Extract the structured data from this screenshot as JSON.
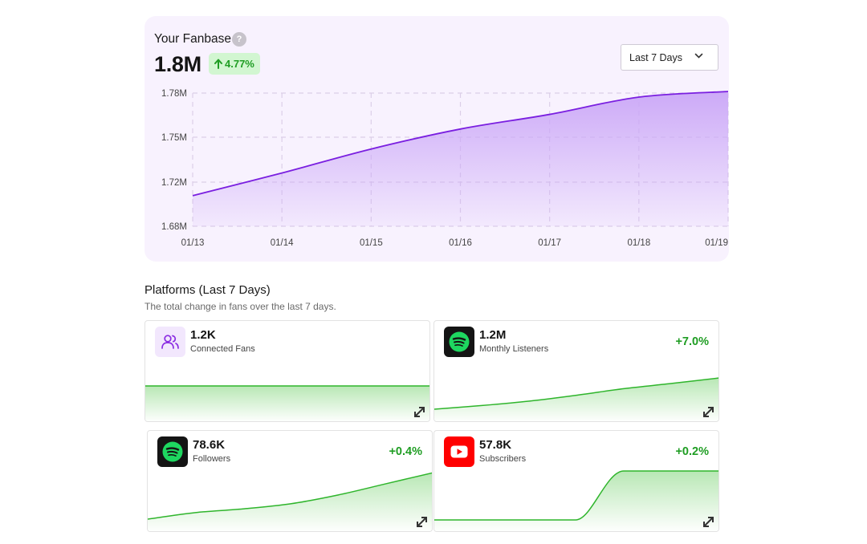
{
  "fanbase": {
    "title": "Your Fanbase",
    "help_glyph": "?",
    "total": "1.8M",
    "change": "4.77%",
    "range_label": "Last 7 Days",
    "accent": "#7a1fe0",
    "fill": "#caa6f7"
  },
  "chart_data": {
    "type": "area",
    "x": [
      "01/13",
      "01/14",
      "01/15",
      "01/16",
      "01/17",
      "01/18",
      "01/19"
    ],
    "y_tick_labels": [
      "1.78M",
      "1.75M",
      "1.72M",
      "1.68M"
    ],
    "series": [
      {
        "values": [
          1.703,
          1.72,
          1.738,
          1.753,
          1.764,
          1.777,
          1.787
        ]
      }
    ],
    "grid": true
  },
  "platforms": {
    "title": "Platforms (Last 7 Days)",
    "subtitle": "The total change in fans over the last 7 days.",
    "cards": [
      {
        "value": "1.2K",
        "label": "Connected Fans",
        "change": "",
        "icon": "people-icon",
        "trend": [
          0.5,
          0.5,
          0.5,
          0.5,
          0.5,
          0.5,
          0.5
        ]
      },
      {
        "value": "1.2M",
        "label": "Monthly Listeners",
        "change": "+7.0%",
        "icon": "spotify-icon",
        "trend": [
          0.0,
          0.1,
          0.22,
          0.38,
          0.56,
          0.7,
          0.85
        ]
      },
      {
        "value": "78.6K",
        "label": "Followers",
        "change": "+0.4%",
        "icon": "spotify-icon",
        "trend": [
          0.0,
          0.14,
          0.22,
          0.33,
          0.52,
          0.76,
          1.0
        ]
      },
      {
        "value": "57.8K",
        "label": "Subscribers",
        "change": "+0.2%",
        "icon": "youtube-icon",
        "trend": [
          0.0,
          0.0,
          0.0,
          0.0,
          0.0,
          1.0,
          1.0,
          1.0
        ]
      }
    ],
    "line_color": "#2fb52c"
  }
}
